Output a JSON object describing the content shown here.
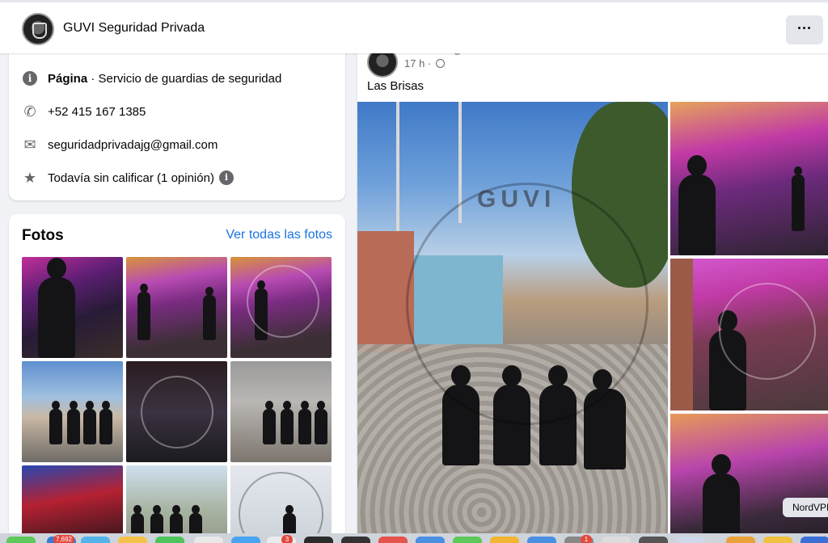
{
  "header": {
    "page_name": "GUVI Seguridad Privada",
    "more_label": "···"
  },
  "intro": {
    "category_bold": "Página",
    "category_rest": " · Servicio de guardias de seguridad",
    "phone": "+52 415 167 1385",
    "email": "seguridadprivadajg@gmail.com",
    "rating": "Todavía sin calificar (1 opinión)"
  },
  "photos": {
    "title": "Fotos",
    "see_all": "Ver todas las fotos"
  },
  "post": {
    "author": "GUVI Seguridad Privada",
    "time": "17 h ·",
    "more_label": "···",
    "text": "Las Brisas",
    "watermark": "GUVI"
  },
  "dock": {
    "badge_1": "7,692",
    "badge_2": "3",
    "badge_3": "1"
  },
  "tooltip": {
    "nordvpn": "NordVPN"
  },
  "icons": {
    "info": "info-icon",
    "phone": "phone-icon",
    "email": "email-icon",
    "star": "star-icon",
    "globe": "globe-icon",
    "more": "more-icon"
  }
}
